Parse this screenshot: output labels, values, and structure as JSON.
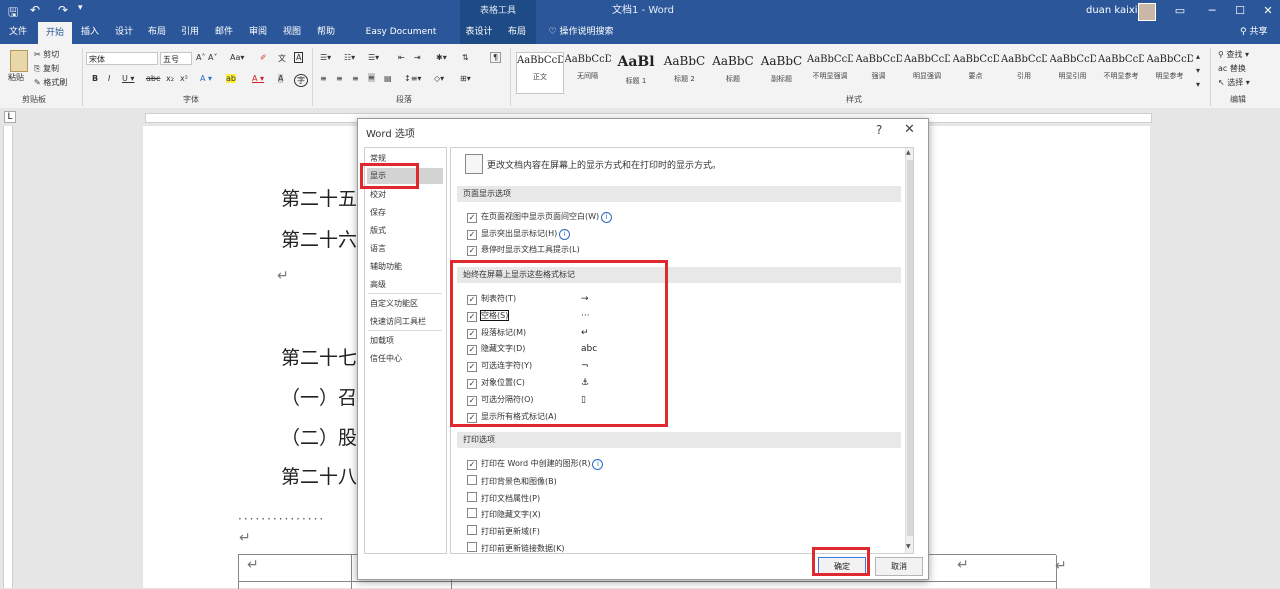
{
  "titlebar": {
    "table_tools": "表格工具",
    "doc_title": "文档1 - Word",
    "user": "duan kaixin"
  },
  "tabs": [
    "文件",
    "开始",
    "插入",
    "设计",
    "布局",
    "引用",
    "邮件",
    "审阅",
    "视图",
    "帮助",
    "Easy Document Creator",
    "表设计",
    "布局",
    "操作说明搜索"
  ],
  "share": "共享",
  "ribbon": {
    "clipboard": {
      "paste": "粘贴",
      "cut": "剪切",
      "copy": "复制",
      "format_painter": "格式刷",
      "label": "剪贴板"
    },
    "font": {
      "name": "宋体",
      "size": "五号",
      "label": "字体"
    },
    "paragraph": {
      "label": "段落"
    },
    "styles": {
      "label": "样式",
      "items": [
        {
          "sample": "AaBbCcD",
          "name": "正文"
        },
        {
          "sample": "AaBbCcD",
          "name": "无间隔"
        },
        {
          "sample": "AaBl",
          "name": "标题 1"
        },
        {
          "sample": "AaBbC",
          "name": "标题 2"
        },
        {
          "sample": "AaBbC",
          "name": "标题"
        },
        {
          "sample": "AaBbC",
          "name": "副标题"
        },
        {
          "sample": "AaBbCcD",
          "name": "不明显强调"
        },
        {
          "sample": "AaBbCcD",
          "name": "强调"
        },
        {
          "sample": "AaBbCcD",
          "name": "明显强调"
        },
        {
          "sample": "AaBbCcD",
          "name": "要点"
        },
        {
          "sample": "AaBbCcD",
          "name": "引用"
        },
        {
          "sample": "AaBbCcD",
          "name": "明显引用"
        },
        {
          "sample": "AaBbCcD",
          "name": "不明显参考"
        },
        {
          "sample": "AaBbCcD",
          "name": "明显参考"
        }
      ]
    },
    "editing": {
      "find": "查找",
      "replace": "替换",
      "select": "选择",
      "label": "编辑"
    }
  },
  "document": {
    "lines": [
      "第二十五",
      "第二十六",
      "第二十七",
      "（一）召",
      "（二）股",
      "第二十八"
    ]
  },
  "dialog": {
    "title": "Word 选项",
    "help": "?",
    "close": "✕",
    "nav": [
      "常规",
      "显示",
      "校对",
      "保存",
      "版式",
      "语言",
      "辅助功能",
      "高级",
      "自定义功能区",
      "快速访问工具栏",
      "加载项",
      "信任中心"
    ],
    "intro": "更改文档内容在屏幕上的显示方式和在打印时的显示方式。",
    "page_display": {
      "title": "页面显示选项",
      "options": [
        {
          "label": "在页面视图中显示页面间空白(W)",
          "checked": true,
          "info": true
        },
        {
          "label": "显示突出显示标记(H)",
          "checked": true,
          "info": true
        },
        {
          "label": "悬停时显示文档工具提示(L)",
          "checked": true,
          "info": false
        }
      ]
    },
    "formatting_marks": {
      "title": "始终在屏幕上显示这些格式标记",
      "options": [
        {
          "label": "制表符(T)",
          "checked": true,
          "symbol": "→"
        },
        {
          "label": "空格(S)",
          "checked": true,
          "symbol": "···"
        },
        {
          "label": "段落标记(M)",
          "checked": true,
          "symbol": "↵"
        },
        {
          "label": "隐藏文字(D)",
          "checked": true,
          "symbol": "abc"
        },
        {
          "label": "可选连字符(Y)",
          "checked": true,
          "symbol": "¬"
        },
        {
          "label": "对象位置(C)",
          "checked": true,
          "symbol": "⚓"
        },
        {
          "label": "可选分隔符(O)",
          "checked": true,
          "symbol": "▯"
        },
        {
          "label": "显示所有格式标记(A)",
          "checked": true,
          "symbol": ""
        }
      ]
    },
    "print": {
      "title": "打印选项",
      "options": [
        {
          "label": "打印在 Word 中创建的图形(R)",
          "checked": true,
          "info": true
        },
        {
          "label": "打印背景色和图像(B)",
          "checked": false,
          "info": false
        },
        {
          "label": "打印文档属性(P)",
          "checked": false,
          "info": false
        },
        {
          "label": "打印隐藏文字(X)",
          "checked": false,
          "info": false
        },
        {
          "label": "打印前更新域(F)",
          "checked": false,
          "info": false
        },
        {
          "label": "打印前更新链接数据(K)",
          "checked": false,
          "info": false
        }
      ]
    },
    "ok": "确定",
    "cancel": "取消"
  },
  "colors": {
    "word_blue": "#2b579a",
    "highlight_red": "#e0282f"
  }
}
